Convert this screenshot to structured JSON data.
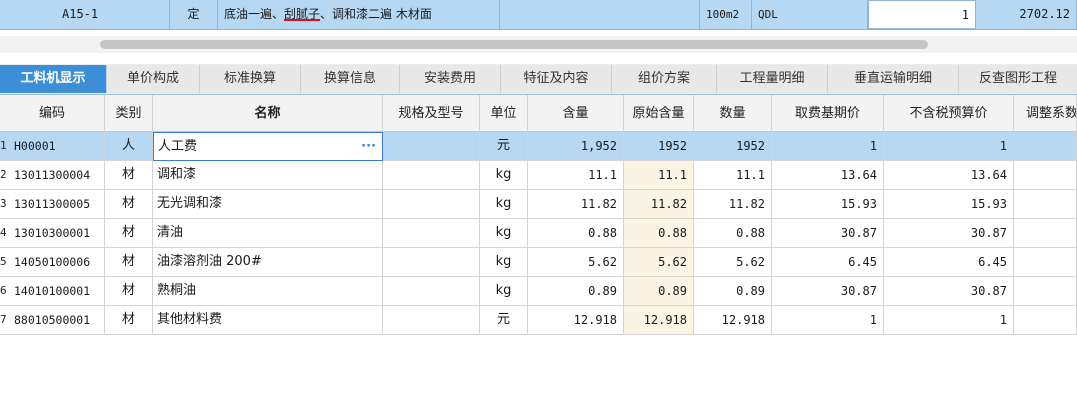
{
  "top_row": {
    "code": "A15-1",
    "type": "定",
    "name_prefix": "底油一遍、",
    "name_underlined": "刮腻子",
    "name_suffix": "、调和漆二遍 木材面",
    "unit": "100m2",
    "qdl": "QDL",
    "quantity": "1",
    "price": "2702.12"
  },
  "tabs": [
    {
      "label": "工料机显示",
      "active": true
    },
    {
      "label": "单价构成",
      "active": false
    },
    {
      "label": "标准换算",
      "active": false
    },
    {
      "label": "换算信息",
      "active": false
    },
    {
      "label": "安装费用",
      "active": false
    },
    {
      "label": "特征及内容",
      "active": false
    },
    {
      "label": "组价方案",
      "active": false
    },
    {
      "label": "工程量明细",
      "active": false
    },
    {
      "label": "垂直运输明细",
      "active": false
    },
    {
      "label": "反查图形工程",
      "active": false
    }
  ],
  "columns": [
    "编码",
    "类别",
    "名称",
    "规格及型号",
    "单位",
    "含量",
    "原始含量",
    "数量",
    "取费基期价",
    "不含税预算价",
    "调整系数"
  ],
  "rows": [
    {
      "n": "1",
      "code": "H00001",
      "cat": "人",
      "name": "人工费",
      "spec": "",
      "unit": "元",
      "content": "1,952",
      "orig": "1952",
      "qty": "1952",
      "base": "1",
      "budget": "1",
      "ellipsis": "···"
    },
    {
      "n": "2",
      "code": "13011300004",
      "cat": "材",
      "name": "调和漆",
      "spec": "",
      "unit": "kg",
      "content": "11.1",
      "orig": "11.1",
      "qty": "11.1",
      "base": "13.64",
      "budget": "13.64"
    },
    {
      "n": "3",
      "code": "13011300005",
      "cat": "材",
      "name": "无光调和漆",
      "spec": "",
      "unit": "kg",
      "content": "11.82",
      "orig": "11.82",
      "qty": "11.82",
      "base": "15.93",
      "budget": "15.93"
    },
    {
      "n": "4",
      "code": "13010300001",
      "cat": "材",
      "name": "清油",
      "spec": "",
      "unit": "kg",
      "content": "0.88",
      "orig": "0.88",
      "qty": "0.88",
      "base": "30.87",
      "budget": "30.87"
    },
    {
      "n": "5",
      "code": "14050100006",
      "cat": "材",
      "name": "油漆溶剂油 200#",
      "spec": "",
      "unit": "kg",
      "content": "5.62",
      "orig": "5.62",
      "qty": "5.62",
      "base": "6.45",
      "budget": "6.45"
    },
    {
      "n": "6",
      "code": "14010100001",
      "cat": "材",
      "name": "熟桐油",
      "spec": "",
      "unit": "kg",
      "content": "0.89",
      "orig": "0.89",
      "qty": "0.89",
      "base": "30.87",
      "budget": "30.87"
    },
    {
      "n": "7",
      "code": "88010500001",
      "cat": "材",
      "name": "其他材料费",
      "spec": "",
      "unit": "元",
      "content": "12.918",
      "orig": "12.918",
      "qty": "12.918",
      "base": "1",
      "budget": "1"
    }
  ],
  "colors": {
    "accent": "#3c8fd6",
    "selection": "#b7d8f3",
    "orig_bg": "#fbf3e4",
    "underline": "#e01010"
  }
}
